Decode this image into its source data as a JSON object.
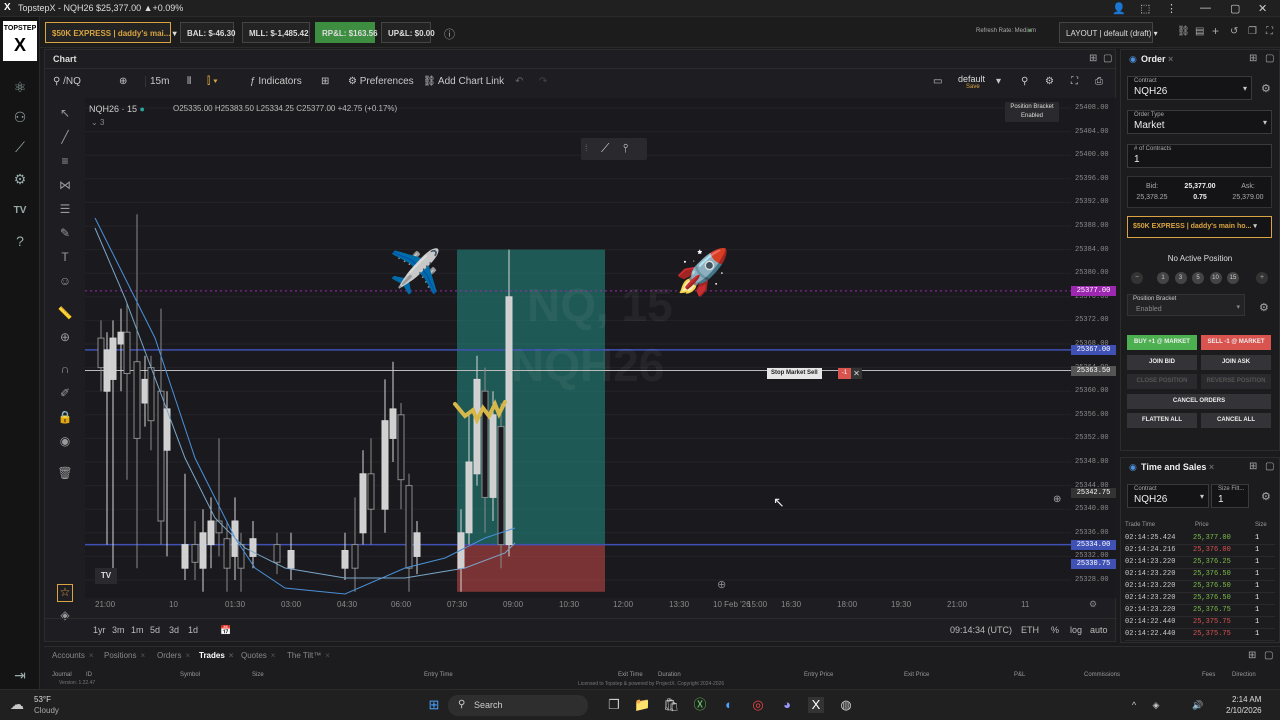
{
  "window": {
    "title": "TopstepX - NQH26 $25,377.00 ▲+0.09%"
  },
  "account": {
    "account_name": "$50K EXPRESS | daddy's mai...",
    "bal": "BAL: $-46.30",
    "mll": "MLL: $-1,485.42",
    "rpl": "RP&L: $163.56",
    "upl": "UP&L: $0.00",
    "refresh": "Refresh Rate: Medium",
    "layout": "LAYOUT | default (draft)"
  },
  "chart": {
    "panel_title": "Chart",
    "symbol_search": "/NQ",
    "interval": "15m",
    "indicators": "Indicators",
    "preferences": "Preferences",
    "add_chart_link": "Add Chart Link",
    "template_name": "default",
    "template_save": "Save",
    "legend_symbol": "NQH26 · 15",
    "legend_ohlc": "O25335.00 H25383.50 L25334.25 C25377.00 +42.75 (+0.17%)",
    "legend_count": "3",
    "watermark_1": "NQ, 15",
    "watermark_2": "NQH26",
    "position_bracket": "Position Bracket",
    "position_bracket_state": "Enabled",
    "stop_order_label": "Stop Market Sell",
    "stop_order_qty": "-1",
    "y_ticks": [
      "25408.00",
      "25404.00",
      "25400.00",
      "25396.00",
      "25392.00",
      "25388.00",
      "25384.00",
      "25380.00",
      "25376.00",
      "25372.00",
      "25368.00",
      "25364.00",
      "25360.00",
      "25356.00",
      "25352.00",
      "25348.00",
      "25344.00",
      "25340.00",
      "25336.00",
      "25332.00",
      "25328.00"
    ],
    "price_badges": {
      "last": "25377.00",
      "line1": "25367.00",
      "stop": "25363.50",
      "cross": "25342.75",
      "line2": "25334.00",
      "low": "25330.75"
    },
    "x_ticks": [
      "21:00",
      "10",
      "01:30",
      "03:00",
      "04:30",
      "06:00",
      "07:30",
      "09:00",
      "10:30",
      "12:00",
      "13:30",
      "10 Feb '26",
      "15:00",
      "16:30",
      "18:00",
      "19:30",
      "21:00",
      "11"
    ],
    "ranges": [
      "1yr",
      "3m",
      "1m",
      "5d",
      "3d",
      "1d"
    ],
    "clock": "09:14:34 (UTC)",
    "session": "ETH",
    "pct": "%",
    "log": "log",
    "auto": "auto"
  },
  "order": {
    "panel_title": "Order",
    "contract_cap": "Contract",
    "contract": "NQH26",
    "type_cap": "Order Type",
    "type": "Market",
    "qty_cap": "# of Contracts",
    "qty": "1",
    "bid_cap": "Bid:",
    "bid": "25,378.25",
    "last": "25,377.00",
    "spread": "0.75",
    "ask_cap": "Ask:",
    "ask": "25,379.00",
    "account": "$50K EXPRESS | daddy's main ho...",
    "no_position": "No Active Position",
    "bracket_cap": "Position Bracket",
    "bracket": "Enabled",
    "qty_presets": [
      "1",
      "3",
      "5",
      "10",
      "15"
    ],
    "buy": "BUY +1 @ MARKET",
    "sell": "SELL -1 @ MARKET",
    "join_bid": "JOIN BID",
    "join_ask": "JOIN ASK",
    "close_position": "CLOSE POSITION",
    "reverse_position": "REVERSE POSITION",
    "cancel_orders": "CANCEL ORDERS",
    "flatten_all": "FLATTEN ALL",
    "cancel_all": "CANCEL ALL"
  },
  "time_sales": {
    "panel_title": "Time and Sales",
    "contract_cap": "Contract",
    "contract": "NQH26",
    "size_filter_cap": "Size Filt...",
    "size_filter": "1",
    "columns": [
      "Trade Time",
      "Price",
      "Size"
    ],
    "rows": [
      {
        "time": "02:14:25.424",
        "price": "25,377.00",
        "size": "1",
        "side": "buy"
      },
      {
        "time": "02:14:24.216",
        "price": "25,376.00",
        "size": "1",
        "side": "sell"
      },
      {
        "time": "02:14:23.220",
        "price": "25,376.25",
        "size": "1",
        "side": "buy"
      },
      {
        "time": "02:14:23.220",
        "price": "25,376.50",
        "size": "1",
        "side": "buy"
      },
      {
        "time": "02:14:23.220",
        "price": "25,376.50",
        "size": "1",
        "side": "buy"
      },
      {
        "time": "02:14:23.220",
        "price": "25,376.50",
        "size": "1",
        "side": "buy"
      },
      {
        "time": "02:14:23.220",
        "price": "25,376.75",
        "size": "1",
        "side": "buy"
      },
      {
        "time": "02:14:22.440",
        "price": "25,375.75",
        "size": "1",
        "side": "sell"
      },
      {
        "time": "02:14:22.440",
        "price": "25,375.75",
        "size": "1",
        "side": "sell"
      }
    ]
  },
  "bottom": {
    "tabs": [
      "Accounts",
      "Positions",
      "Orders",
      "Trades",
      "Quotes",
      "The Tilt™"
    ],
    "active_tab": "Trades",
    "columns": [
      "Journal",
      "ID",
      "Symbol",
      "Size",
      "Entry Time",
      "Exit Time",
      "Duration",
      "Entry Price",
      "Exit Price",
      "P&L",
      "Commissions",
      "Fees",
      "Direction"
    ],
    "license": "Licensed to Topstep & powered by ProjectX. Copyright 2024-2026",
    "version": "Version: 1.22.47"
  },
  "taskbar": {
    "weather_temp": "53°F",
    "weather_desc": "Cloudy",
    "search": "Search",
    "time": "2:14 AM",
    "date": "2/10/2026"
  },
  "colors": {
    "bull": "#26a69a",
    "bear": "#ef5350",
    "accent": "#d9a441",
    "buy": "#4caf50",
    "sell": "#d9534f"
  }
}
